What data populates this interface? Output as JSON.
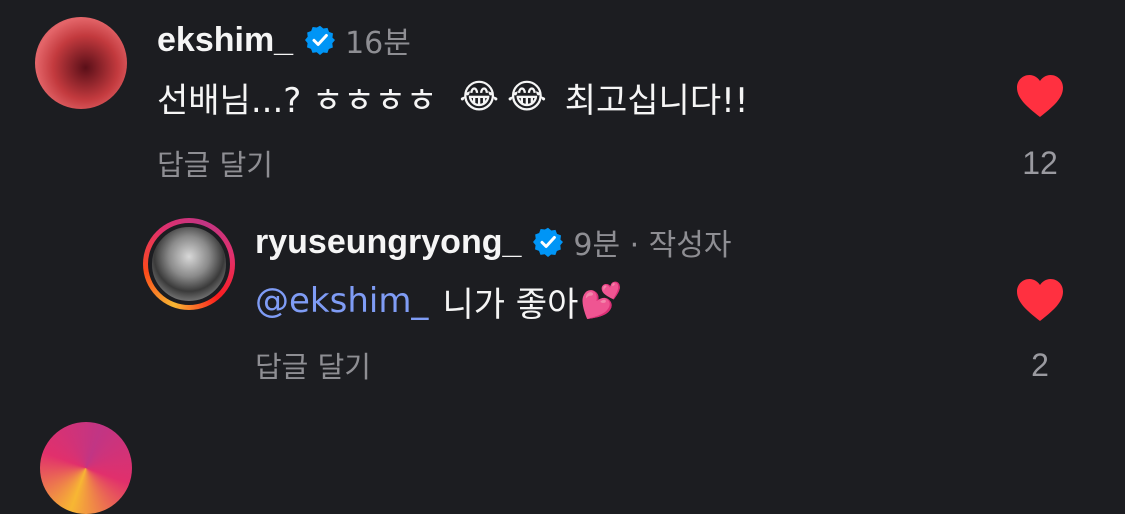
{
  "comments": [
    {
      "username": "ekshim_",
      "time": "16분",
      "text": "선배님...? ㅎㅎㅎㅎ",
      "emojis": [
        "😂",
        "😂"
      ],
      "text_after": "최고십니다!!",
      "reply_label": "답글 달기",
      "likes": "12",
      "liked": true
    },
    {
      "username": "ryuseungryong_",
      "time": "9분 · 작성자",
      "mention": "@ekshim_",
      "text": "니가 좋아",
      "emoji": "💕",
      "reply_label": "답글 달기",
      "likes": "2",
      "liked": true
    }
  ],
  "colors": {
    "background": "#1c1d21",
    "heart": "#ff3040",
    "verified": "#0095f6",
    "mention": "#7f9cf5",
    "secondary_text": "#8e8e93"
  }
}
